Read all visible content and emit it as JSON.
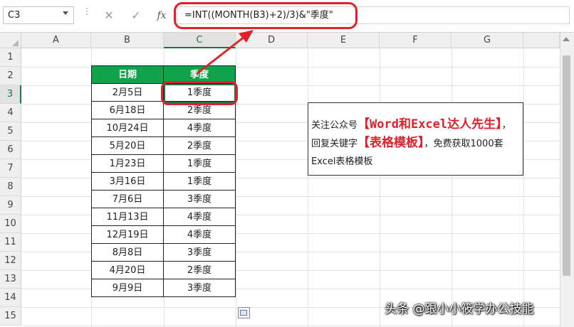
{
  "formula_bar": {
    "name_box": "C3",
    "cancel_glyph": "✕",
    "enter_glyph": "✓",
    "fx_label": "fx",
    "formula": "=INT((MONTH(B3)+2)/3)&\"季度\""
  },
  "columns": [
    "A",
    "B",
    "C",
    "D",
    "E",
    "F",
    "G"
  ],
  "rows": [
    "1",
    "2",
    "3",
    "4",
    "5",
    "6",
    "7",
    "8",
    "9",
    "10",
    "11",
    "12",
    "13",
    "14",
    "15"
  ],
  "active_cell": "C3",
  "table": {
    "headers": [
      "日期",
      "季度"
    ],
    "rows": [
      [
        "2月5日",
        "1季度"
      ],
      [
        "6月18日",
        "2季度"
      ],
      [
        "10月24日",
        "4季度"
      ],
      [
        "5月20日",
        "2季度"
      ],
      [
        "1月23日",
        "1季度"
      ],
      [
        "3月16日",
        "1季度"
      ],
      [
        "7月6日",
        "3季度"
      ],
      [
        "11月13日",
        "4季度"
      ],
      [
        "12月19日",
        "4季度"
      ],
      [
        "8月8日",
        "3季度"
      ],
      [
        "4月20日",
        "2季度"
      ],
      [
        "9月9日",
        "3季度"
      ]
    ],
    "header_color": "#0fa34a"
  },
  "note": {
    "part1": "关注公众号",
    "highlight1": "【Word和Excel达人先生】",
    "part2": "，回复关键字",
    "highlight2": "【表格模板】",
    "part3": "，免费获取1000套Excel表格模板"
  },
  "watermark": "头条 @跟小小筱学办公技能",
  "accent_colors": {
    "excel_green": "#217346",
    "annotation_red": "#e0202a"
  }
}
